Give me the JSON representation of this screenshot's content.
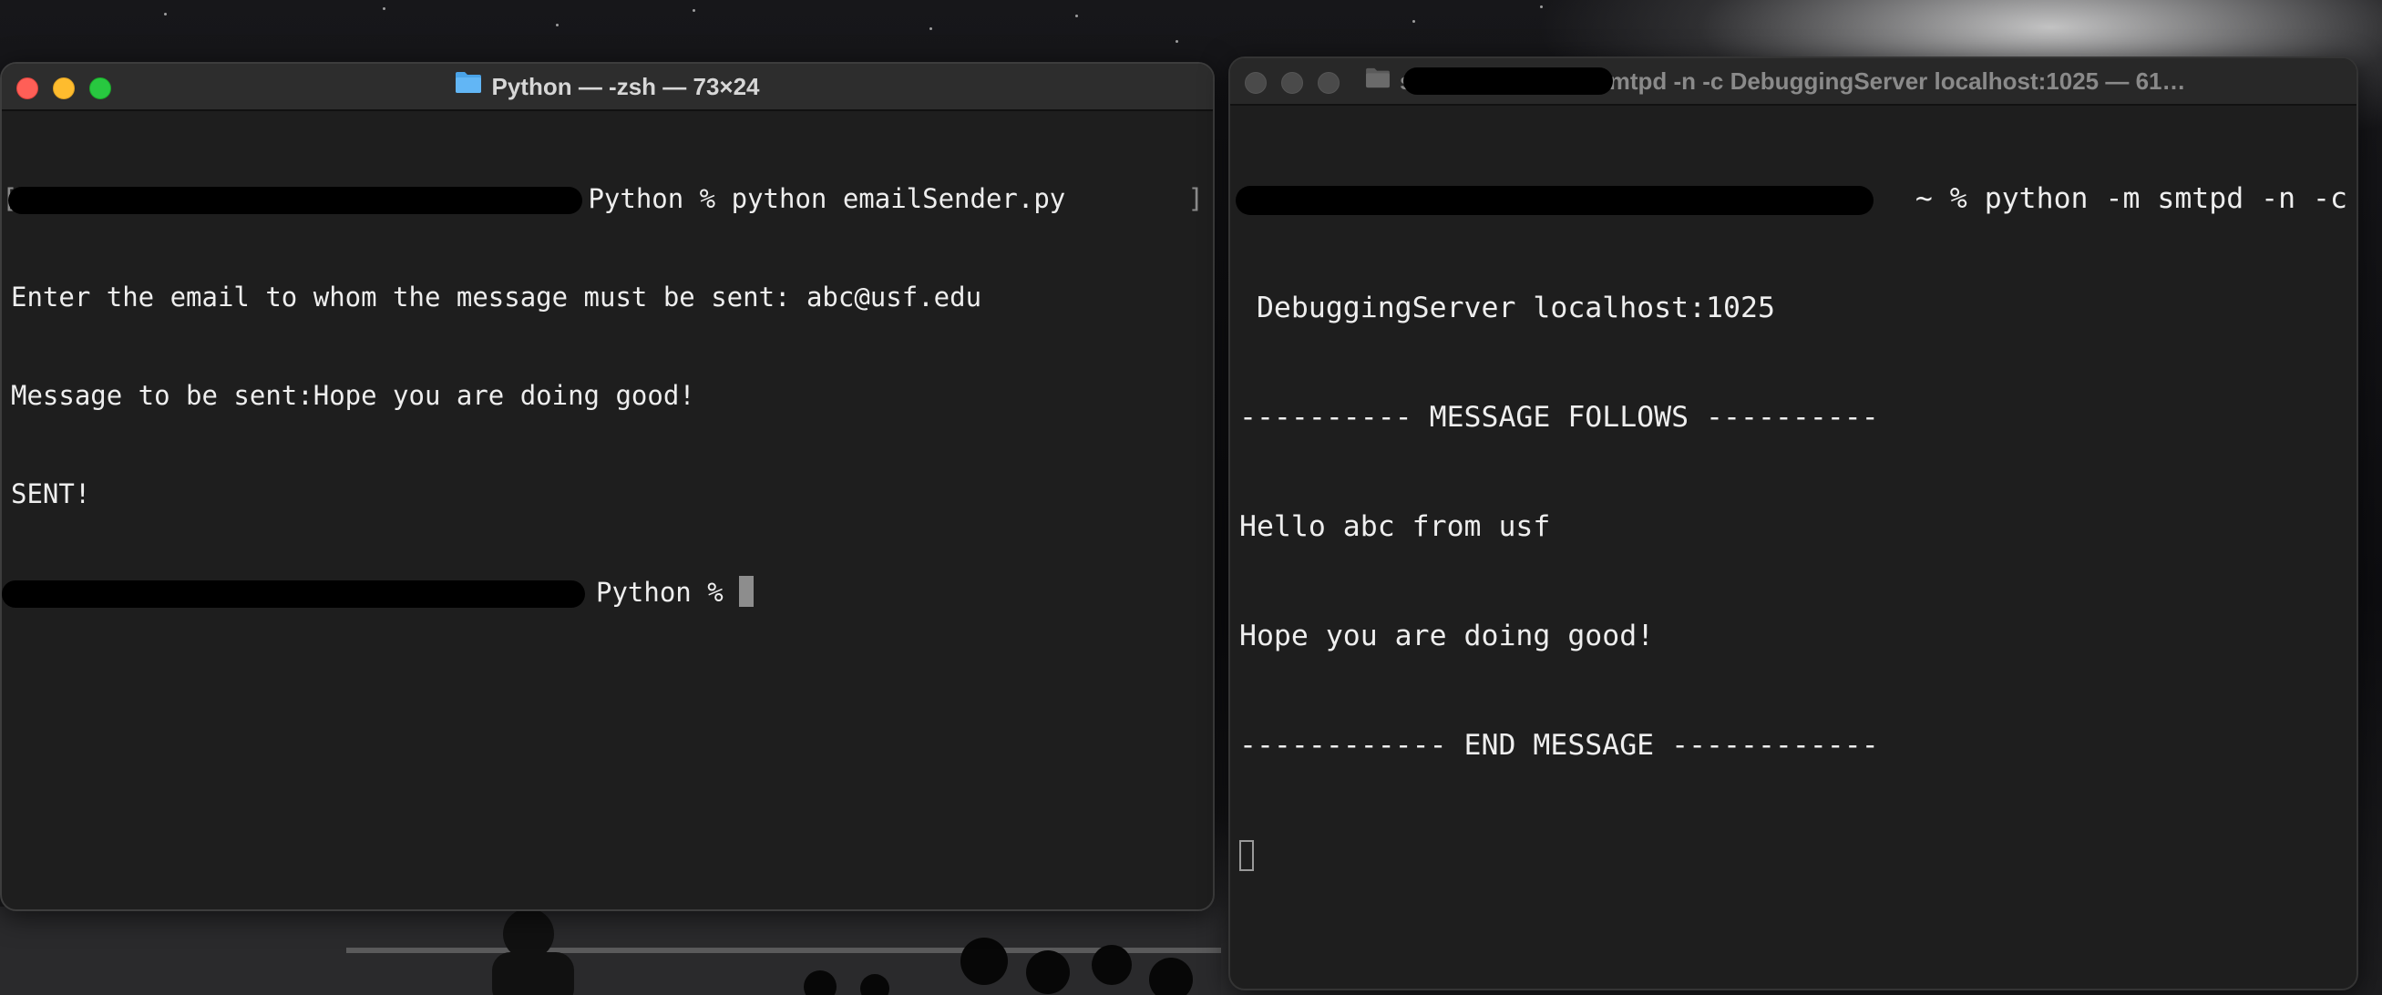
{
  "left_window": {
    "title": "Python — -zsh — 73×24",
    "prompt_suffix": "Python % python emailSender.py",
    "input_prompt_line": "Enter the email to whom the message must be sent: abc@usf.edu",
    "message_line": "Message to be sent:Hope you are doing good!",
    "sent_line": "SENT!",
    "final_prompt": "Python %",
    "bracket_open": "[",
    "bracket_close": "]"
  },
  "right_window": {
    "title": "s… — Python -m smtpd -n -c DebuggingServer localhost:1025 — 61…",
    "prompt_command": "~ % python -m smtpd -n -c",
    "command_continuation": " DebuggingServer localhost:1025",
    "message_follows": "---------- MESSAGE FOLLOWS ----------",
    "body_line_1": "Hello abc from usf",
    "body_line_2": "Hope you are doing good!",
    "end_message": "------------ END MESSAGE ------------"
  },
  "colors": {
    "terminal_bg": "#1e1e1e",
    "terminal_text": "#eeeeee",
    "close": "#ff5f57",
    "minimize": "#febc2e",
    "maximize": "#28c840"
  },
  "icons": {
    "folder": "folder-icon"
  }
}
